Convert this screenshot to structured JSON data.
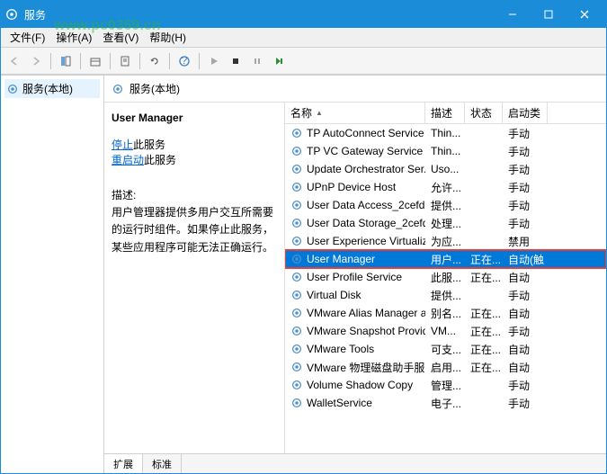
{
  "window": {
    "title": "服务"
  },
  "watermark": "www.pc0359.cn",
  "menus": {
    "file": "文件(F)",
    "action": "操作(A)",
    "view": "查看(V)",
    "help": "帮助(H)"
  },
  "tree": {
    "root": "服务(本地)"
  },
  "detail": {
    "header": "服务(本地)",
    "selected_name": "User Manager",
    "stop_label": "停止",
    "stop_suffix": "此服务",
    "restart_label": "重启动",
    "restart_suffix": "此服务",
    "desc_label": "描述:",
    "desc_text": "用户管理器提供多用户交互所需要的运行时组件。如果停止此服务，某些应用程序可能无法正确运行。"
  },
  "columns": {
    "name": "名称",
    "desc": "描述",
    "status": "状态",
    "startup": "启动类"
  },
  "rows": [
    {
      "name": "TP AutoConnect Service",
      "desc": "Thin...",
      "status": "",
      "startup": "手动"
    },
    {
      "name": "TP VC Gateway Service",
      "desc": "Thin...",
      "status": "",
      "startup": "手动"
    },
    {
      "name": "Update Orchestrator Ser...",
      "desc": "Uso...",
      "status": "",
      "startup": "手动"
    },
    {
      "name": "UPnP Device Host",
      "desc": "允许...",
      "status": "",
      "startup": "手动"
    },
    {
      "name": "User Data Access_2cefd",
      "desc": "提供...",
      "status": "",
      "startup": "手动"
    },
    {
      "name": "User Data Storage_2cefd",
      "desc": "处理...",
      "status": "",
      "startup": "手动"
    },
    {
      "name": "User Experience Virtualiz...",
      "desc": "为应...",
      "status": "",
      "startup": "禁用"
    },
    {
      "name": "User Manager",
      "desc": "用户...",
      "status": "正在...",
      "startup": "自动(触",
      "selected": true
    },
    {
      "name": "User Profile Service",
      "desc": "此服...",
      "status": "正在...",
      "startup": "自动"
    },
    {
      "name": "Virtual Disk",
      "desc": "提供...",
      "status": "",
      "startup": "手动"
    },
    {
      "name": "VMware Alias Manager a...",
      "desc": "别名...",
      "status": "正在...",
      "startup": "自动"
    },
    {
      "name": "VMware Snapshot Provid...",
      "desc": "VM...",
      "status": "正在...",
      "startup": "手动"
    },
    {
      "name": "VMware Tools",
      "desc": "可支...",
      "status": "正在...",
      "startup": "自动"
    },
    {
      "name": "VMware 物理磁盘助手服务",
      "desc": "启用...",
      "status": "正在...",
      "startup": "自动"
    },
    {
      "name": "Volume Shadow Copy",
      "desc": "管理...",
      "status": "",
      "startup": "手动"
    },
    {
      "name": "WalletService",
      "desc": "电子...",
      "status": "",
      "startup": "手动"
    }
  ],
  "tabs": {
    "extended": "扩展",
    "standard": "标准"
  }
}
